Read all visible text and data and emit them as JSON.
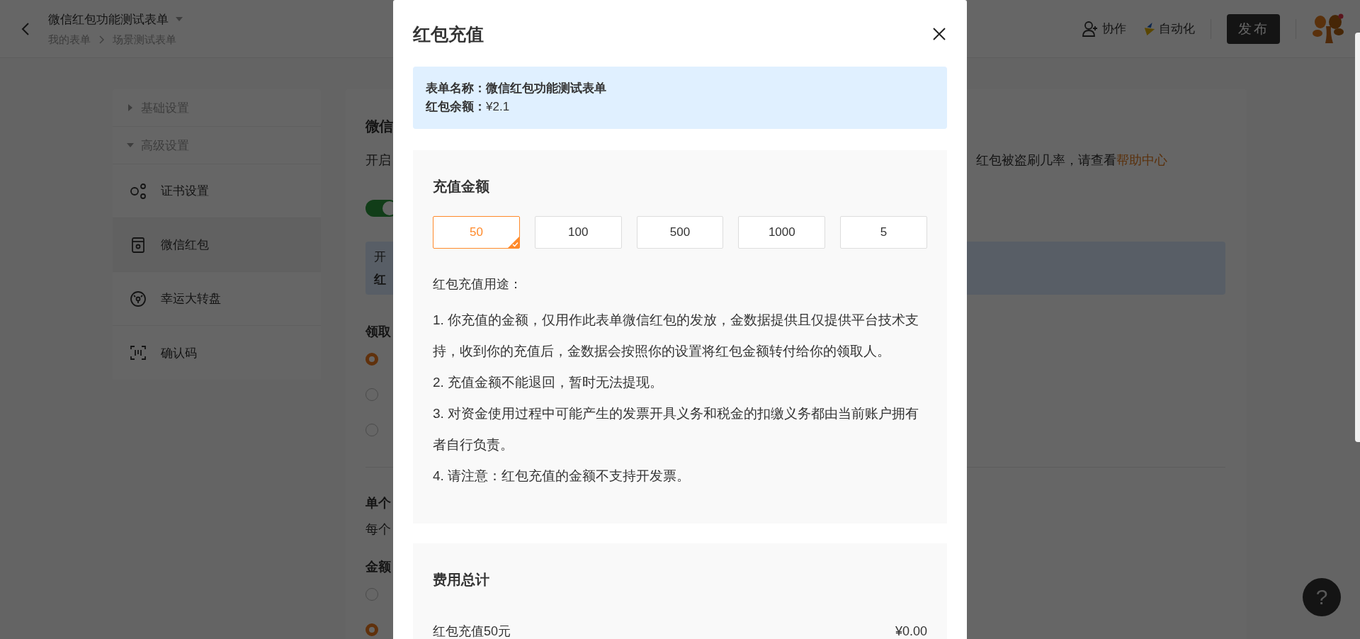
{
  "header": {
    "title": "微信红包功能测试表单",
    "breadcrumb": [
      {
        "label": "我的表单"
      },
      {
        "label": "场景测试表单"
      }
    ],
    "actions": [
      {
        "kind": "collaborate",
        "label": "协作"
      },
      {
        "kind": "automation",
        "label": "自动化"
      }
    ],
    "publish_button": "发布"
  },
  "sidebar": [
    {
      "label": "基础设置",
      "expanded": false
    },
    {
      "label": "高级设置",
      "expanded": true,
      "children": [
        {
          "kind": "certificate",
          "label": "证书设置",
          "selected": false
        },
        {
          "kind": "red_packet",
          "label": "微信红包",
          "selected": true
        },
        {
          "kind": "wheel",
          "label": "幸运大转盘",
          "selected": false
        },
        {
          "kind": "code",
          "label": "确认码",
          "selected": false
        }
      ]
    }
  ],
  "content": {
    "title": "微信",
    "description": "开启",
    "description_end": "红包被盗刷几率，请查看",
    "help_link": "帮助中心",
    "switch_on": true,
    "notice": {
      "line_1": "开",
      "line_2": "红"
    },
    "claim": {
      "title": "领取",
      "options": [
        {
          "selected": true
        },
        {
          "selected": false
        },
        {
          "selected": false
        }
      ]
    },
    "single": {
      "title": "单个",
      "text": "每个"
    },
    "amount": {
      "title": "金额",
      "options": [
        {
          "selected": false
        },
        {
          "selected": true
        }
      ]
    }
  },
  "modal": {
    "title": "红包充值",
    "form_name": "表单名称：微信红包功能测试表单",
    "balance": "**红包余额：**¥2.1",
    "recharge_title": "充值金额",
    "amounts": [
      {
        "label": "50",
        "selected": true
      },
      {
        "label": "100",
        "selected": false
      },
      {
        "label": "500",
        "selected": false
      },
      {
        "label": "1000",
        "selected": false
      },
      {
        "label": "5",
        "selected": false
      }
    ],
    "usage_title": "红包充值用途：",
    "usage_items": [
      "1. 你充值的金额，仅用作此表单微信红包的发放，金数据提供且仅提供平台技术支持，收到你的充值后，金数据会按照你的设置将红包金额转付给你的领取人。",
      "2. 充值金额不能退回，暂时无法提现。",
      "3. 对资金使用过程中可能产生的发票开具义务和税金的扣缴义务都由当前账户拥有者自行负责。",
      "4. 请注意：红包充值的金额不支持开发票。"
    ],
    "total": {
      "title": "费用总计",
      "rows": [
        {
          "label": "红包充值50元",
          "value": "¥0.00"
        }
      ]
    }
  },
  "help_button": "?"
}
